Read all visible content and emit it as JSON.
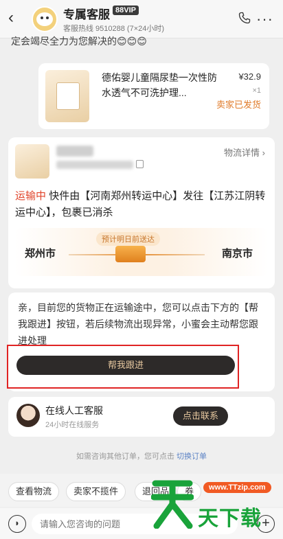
{
  "header": {
    "back_icon": "chevron-left-icon",
    "title": "专属客服",
    "vip_badge": "88VIP",
    "hotline": "客服热线 9510288 (7×24小时)",
    "phone_icon": "phone-icon",
    "more_icon": "more-dots-icon"
  },
  "chat": {
    "prev_message_tail": "定会竭尽全力为您解决的😊😊😊",
    "product": {
      "name": "德佑婴儿童隔尿垫一次性防水透气不可洗护理...",
      "price": "¥32.9",
      "quantity": "×1",
      "status": "卖家已发货"
    },
    "logistics": {
      "detail_link": "物流详情 ›",
      "status_label": "运输中",
      "status_text": "快件由【河南郑州转运中心】发往【江苏江阴转运中心】，包裹已消杀",
      "badge": "预计明日前送达",
      "from_city": "郑州市",
      "to_city": "南京市"
    },
    "message": {
      "text": "亲，目前您的货物正在运输途中，您可以点击下方的【帮我跟进】按钮，若后续物流出现异常，小蜜会主动帮您跟进处理",
      "button": "帮我跟进"
    },
    "agent": {
      "title": "在线人工客服",
      "subtitle": "24小时在线服务",
      "button": "点击联系"
    },
    "switch_hint": "如需咨询其他订单，您可点击",
    "switch_link": "切换订单"
  },
  "quick_actions": [
    "查看物流",
    "卖家不揽件",
    "退回品",
    "券"
  ],
  "input": {
    "placeholder": "请输入您咨询的问题",
    "voice_icon": "voice-icon",
    "plus_icon": "plus-icon"
  },
  "watermark": {
    "url": "www.TTzip.com",
    "text": "天下载"
  },
  "colors": {
    "accent_orange": "#e07b2a",
    "status_red": "#e0432a",
    "button_dark": "#2d2a29",
    "highlight_frame": "#e02323",
    "watermark_green": "#19a33a"
  }
}
